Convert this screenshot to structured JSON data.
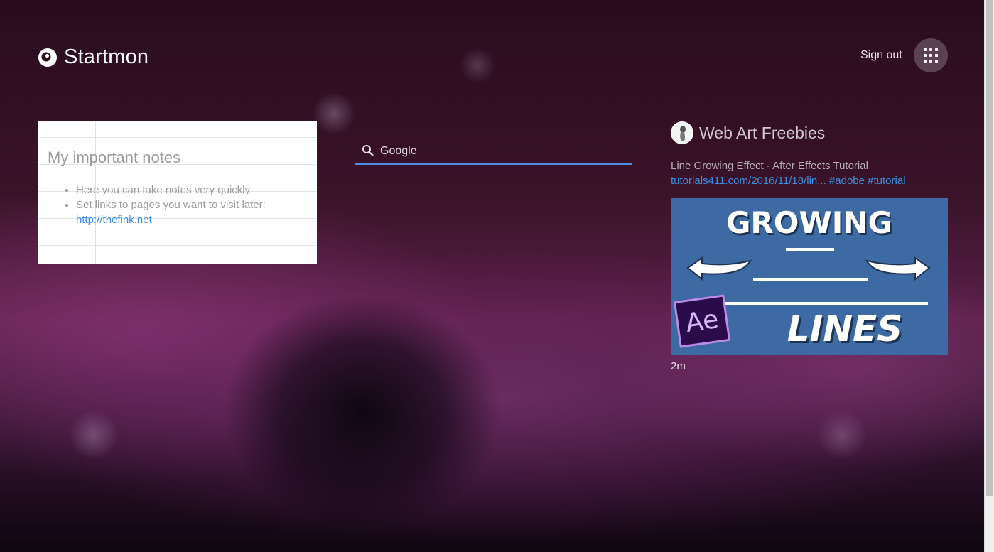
{
  "header": {
    "app_name": "Startmon",
    "signout_label": "Sign out",
    "apps_icon": "grid-icon",
    "logo_icon": "eye-icon"
  },
  "notes": {
    "title": "My important notes",
    "items": [
      "Here you can take notes very quickly",
      "Set links to pages you want to visit later:"
    ],
    "link_text": "http://thefink.net"
  },
  "search": {
    "placeholder": "Google",
    "icon": "search-icon",
    "accent_color": "#4d8ee6"
  },
  "feed": {
    "source_name": "Web Art Freebies",
    "post": {
      "title": "Line Growing Effect - After Effects Tutorial",
      "link": "tutorials411.com/2016/11/18/lin...",
      "tags": [
        "#adobe",
        "#tutorial"
      ],
      "image_text_top": "GROWING",
      "image_text_bottom": "LINES",
      "image_badge": "Ae",
      "time": "2m"
    }
  },
  "colors": {
    "link": "#3c8ee0",
    "thumbnail_bg": "#3d6aa2"
  }
}
